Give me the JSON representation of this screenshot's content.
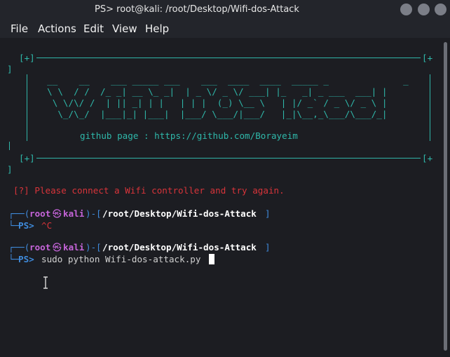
{
  "window": {
    "title": "PS> root@kali: /root/Desktop/Wifi-dos-Attack"
  },
  "menu": [
    "File",
    "Actions",
    "Edit",
    "View",
    "Help"
  ],
  "banner": {
    "corner": "[+]",
    "corner_cut": "[+",
    "bracket": "]",
    "github_line": "github page : https://github.com/Borayeim",
    "art": [
      "  __    __    ___ _____ ___    ___  ____  ____  _____ _              _ ",
      "  \\ \\  / /  /_ _| __ \\_ _|  | _ \\/ _ \\/ ___| |_   _| _ ___  ___| |",
      "   \\ \\/\\/ /  | || _| | |   | | |  (_) \\__ \\   | |/ _` / _ \\/ _ \\ |",
      "    \\_/\\_/  |___|_| |___|  |___/ \\___/|___/   |_|\\__,_\\___/\\___/_|"
    ]
  },
  "error": "[?] Please connect a Wifi controller and try again.",
  "prompts": [
    {
      "top_open": "┌──(",
      "user": "root",
      "at": "㉿",
      "host": "kali",
      "mid": ")-[",
      "path": "/root/Desktop/Wifi-dos-Attack",
      "close": "]",
      "bottom": "└─",
      "ps": "PS>",
      "command": "^C"
    },
    {
      "top_open": "┌──(",
      "user": "root",
      "at": "㉿",
      "host": "kali",
      "mid": ")-[",
      "path": "/root/Desktop/Wifi-dos-Attack",
      "close": "]",
      "bottom": "└─",
      "ps": "PS>",
      "command": "sudo python Wifi-dos-attack.py"
    }
  ],
  "colors": {
    "teal": "#2fb8aa",
    "red": "#d8343a",
    "blue": "#3f8bdc",
    "purple": "#c564d9"
  },
  "icons": [
    "window-minimize-icon",
    "window-maximize-icon",
    "window-close-icon",
    "text-cursor-icon"
  ]
}
